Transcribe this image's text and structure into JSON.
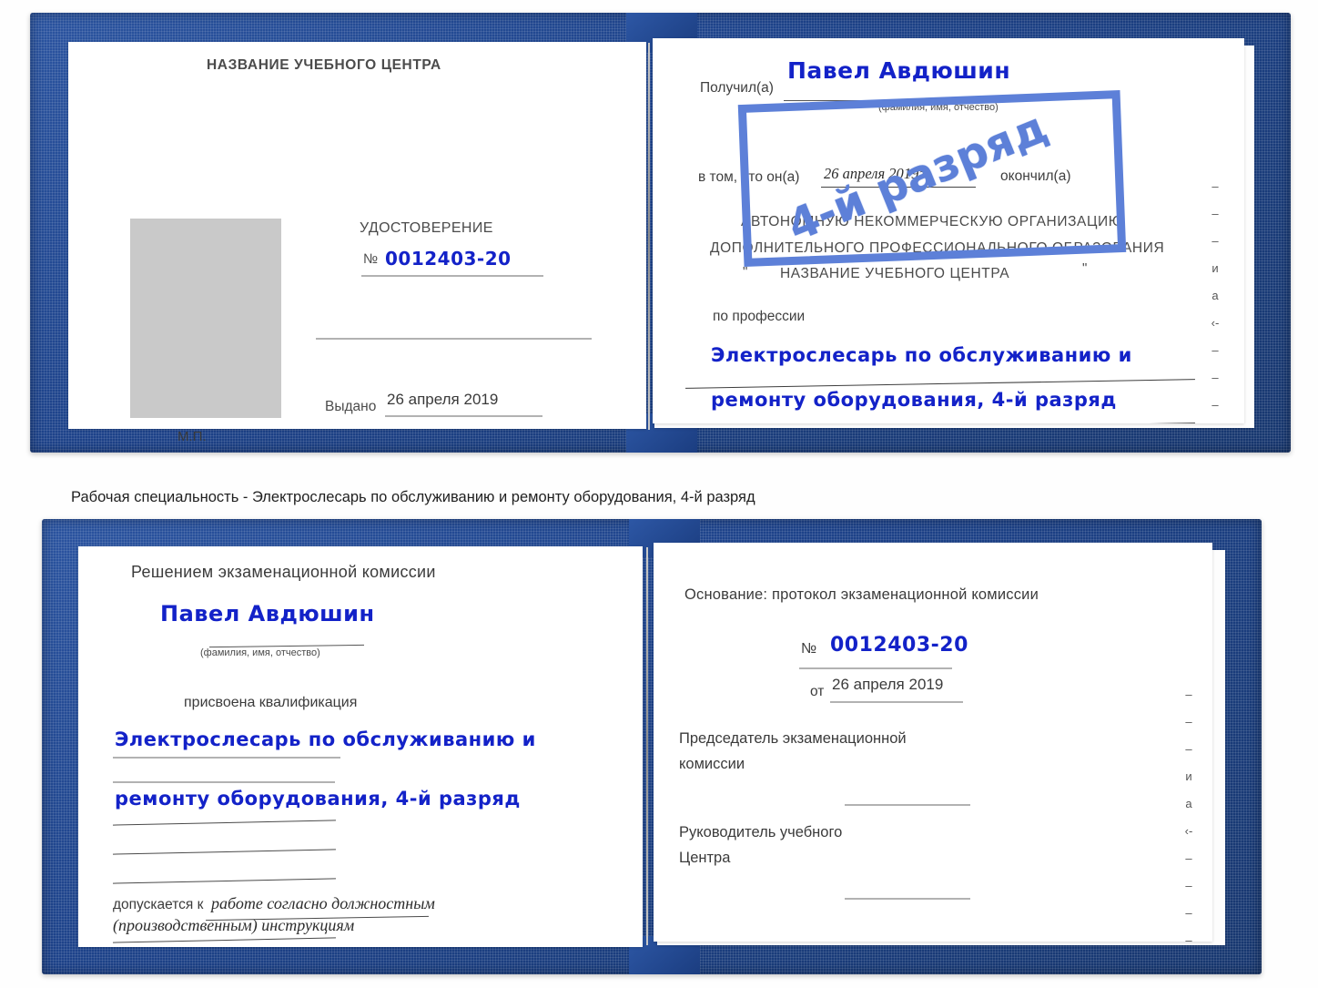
{
  "caption": {
    "text": "Рабочая специальность - Электрослесарь по обслуживанию и ремонту оборудования, 4-й разряд"
  },
  "certificate_top": {
    "left_page": {
      "header": "НАЗВАНИЕ УЧЕБНОГО ЦЕНТРА",
      "doc_title": "УДОСТОВЕРЕНИЕ",
      "number_label": "№",
      "number_value": "0012403-20",
      "issued_label": "Выдано",
      "issued_value": "26 апреля 2019",
      "seal_label": "М.П.",
      "photo_placeholder": "photo-placeholder"
    },
    "right_page": {
      "received_label": "Получил(а)",
      "received_value": "Павел Авдюшин",
      "name_hint": "(фамилия, имя, отчество)",
      "that_he_label": "в том, что он(а)",
      "date_value": "26 апреля 2019г.",
      "finished_label": "окончил(а)",
      "org_line1": "АВТОНОМНУЮ НЕКОММЕРЧЕСКУЮ ОРГАНИЗАЦИЮ",
      "org_line2": "ДОПОЛНИТЕЛЬНОГО ПРОФЕССИОНАЛЬНОГО ОБРАЗОВАНИЯ",
      "org_quote_open": "\"",
      "org_name": "НАЗВАНИЕ УЧЕБНОГО ЦЕНТРА",
      "org_quote_close": "\"",
      "profession_label": "по профессии",
      "profession_line1": "Электрослесарь по обслуживанию и",
      "profession_line2": "ремонту оборудования, 4-й разряд",
      "stamp_text": "4-й разряд",
      "edge_fragments": "–\n–\n–\nи\nа\n‹-\n–\n–\n–\n–"
    }
  },
  "certificate_bottom": {
    "left_page": {
      "header": "Решением экзаменационной комиссии",
      "name_value": "Павел Авдюшин",
      "name_hint": "(фамилия, имя, отчество)",
      "qualification_label": "присвоена квалификация",
      "qualification_line1": "Электрослесарь по обслуживанию и",
      "qualification_line2": "ремонту оборудования, 4-й разряд",
      "allowed_label": "допускается к",
      "allowed_line1": "работе согласно должностным",
      "allowed_line2": "(производственным) инструкциям"
    },
    "right_page": {
      "basis_label": "Основание: протокол экзаменационной комиссии",
      "number_label": "№",
      "number_value": "0012403-20",
      "date_label": "от",
      "date_value": "26 апреля 2019",
      "chair_line1": "Председатель экзаменационной",
      "chair_line2": "комиссии",
      "head_line1": "Руководитель учебного",
      "head_line2": "Центра",
      "edge_fragments": "–\n–\n–\nи\nа\n‹-\n–\n–\n–\n–"
    }
  },
  "colors": {
    "cover_blue": "#1d4289",
    "ink_blue": "#1322c8",
    "stamp_blue": "#5d80d8",
    "rule_gray": "#b2b2b2",
    "photo_gray": "#c9c9c9"
  }
}
